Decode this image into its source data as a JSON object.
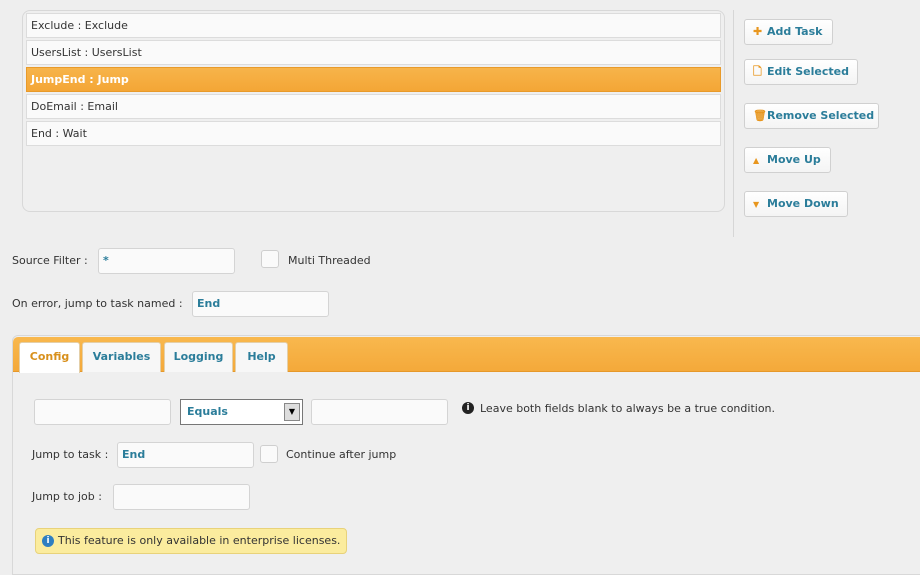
{
  "tasks": [
    {
      "label": "Exclude : Exclude",
      "selected": false
    },
    {
      "label": "UsersList : UsersList",
      "selected": false
    },
    {
      "label": "JumpEnd : Jump",
      "selected": true
    },
    {
      "label": "DoEmail : Email",
      "selected": false
    },
    {
      "label": "End : Wait",
      "selected": false
    }
  ],
  "buttons": {
    "add": "Add Task",
    "edit": "Edit Selected",
    "remove": "Remove Selected",
    "up": "Move Up",
    "down": "Move Down"
  },
  "source_filter": {
    "label": "Source Filter :",
    "value": "*"
  },
  "multi_threaded": {
    "label": "Multi Threaded",
    "checked": false
  },
  "on_error": {
    "label": "On error, jump to task named :",
    "value": "End"
  },
  "tabs": [
    {
      "label": "Config",
      "active": true
    },
    {
      "label": "Variables"
    },
    {
      "label": "Logging"
    },
    {
      "label": "Help"
    }
  ],
  "config": {
    "left_value": "",
    "operator": "Equals",
    "right_value": "",
    "hint": "Leave both fields blank to always be a true condition.",
    "jump_task_label": "Jump to task :",
    "jump_task_value": "End",
    "continue_label": "Continue after jump",
    "continue_checked": false,
    "jump_job_label": "Jump to job :",
    "jump_job_value": "",
    "notice": "This feature is only available in enterprise licenses."
  },
  "colors": {
    "accent": "#f4a93a",
    "link": "#2b7d9a",
    "info_blue": "#2f7fc1"
  }
}
